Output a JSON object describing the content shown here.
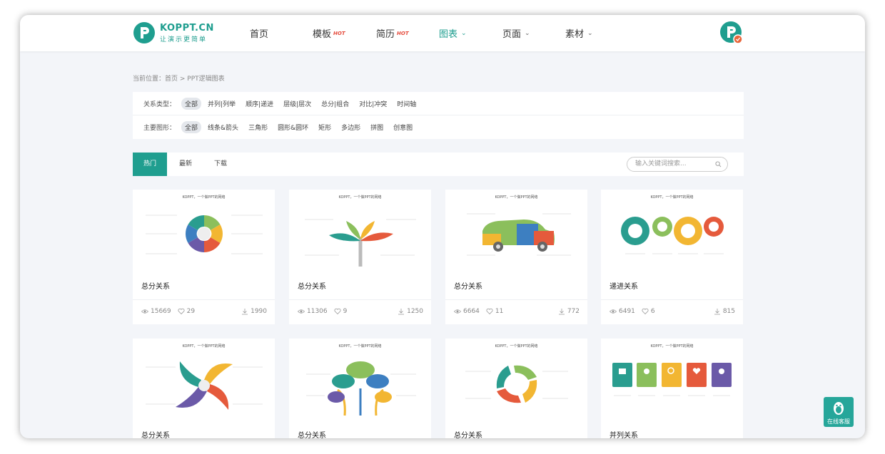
{
  "brand": {
    "name": "KOPPT.CN",
    "slogan": "让演示更简单",
    "teal": "#1f9e8f"
  },
  "nav": [
    {
      "label": "首页",
      "hot": "",
      "dropdown": false,
      "active": false
    },
    {
      "label": "模板",
      "hot": "HOT",
      "dropdown": false,
      "active": false
    },
    {
      "label": "简历",
      "hot": "HOT",
      "dropdown": false,
      "active": false
    },
    {
      "label": "图表",
      "hot": "",
      "dropdown": true,
      "active": true
    },
    {
      "label": "页面",
      "hot": "",
      "dropdown": true,
      "active": false
    },
    {
      "label": "素材",
      "hot": "",
      "dropdown": true,
      "active": false
    }
  ],
  "breadcrumb": "当前位置：首页 > PPT逻辑图表",
  "filters": {
    "relation": {
      "label": "关系类型：",
      "options": [
        "全部",
        "并列|列举",
        "顺序|递进",
        "层级|层次",
        "总分|组合",
        "对比|冲突",
        "时间轴"
      ]
    },
    "shape": {
      "label": "主要图形：",
      "options": [
        "全部",
        "线条&箭头",
        "三角形",
        "圆形&圆环",
        "矩形",
        "多边形",
        "拼图",
        "创意图"
      ]
    }
  },
  "tabs": [
    "热门",
    "最新",
    "下载"
  ],
  "search": {
    "placeholder": "输入关键词搜索..."
  },
  "thumb_caption": "KOPPT，一个做PPT的网络",
  "cards": [
    {
      "title": "总分关系",
      "views": "15669",
      "likes": "29",
      "downloads": "1990"
    },
    {
      "title": "总分关系",
      "views": "11306",
      "likes": "9",
      "downloads": "1250"
    },
    {
      "title": "总分关系",
      "views": "6664",
      "likes": "11",
      "downloads": "772"
    },
    {
      "title": "递进关系",
      "views": "6491",
      "likes": "6",
      "downloads": "815"
    },
    {
      "title": "总分关系",
      "views": "",
      "likes": "",
      "downloads": ""
    },
    {
      "title": "总分关系",
      "views": "",
      "likes": "",
      "downloads": ""
    },
    {
      "title": "总分关系",
      "views": "",
      "likes": "",
      "downloads": ""
    },
    {
      "title": "并列关系",
      "views": "",
      "likes": "",
      "downloads": ""
    }
  ],
  "service": {
    "label": "在线客服"
  },
  "icons": {
    "views": "eye-icon",
    "likes": "heart-icon",
    "downloads": "download-icon"
  }
}
